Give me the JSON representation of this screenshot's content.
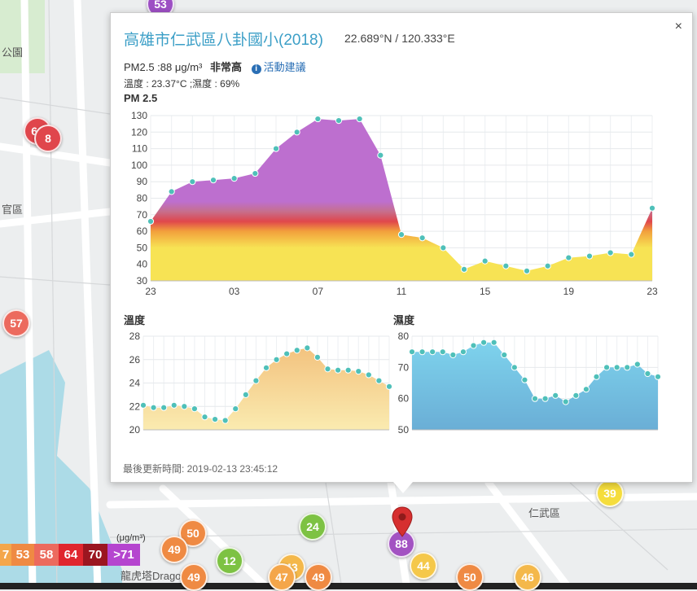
{
  "popup": {
    "title": "高雄市仁武區八卦國小(2018)",
    "coords": "22.689°N / 120.333°E",
    "pm_label": "PM2.5 :88 μg/m³",
    "pm_level": "非常高",
    "advice": "活動建議",
    "weather": "溫度 : 23.37°C ;濕度 : 69%",
    "pm_chart_title": "PM 2.5",
    "temp_chart_title": "溫度",
    "hum_chart_title": "濕度",
    "updated": "最後更新時間: 2019-02-13 23:45:12",
    "close": "×"
  },
  "legend": {
    "unit": "(μg/m³)",
    "items": [
      {
        "label": "7",
        "color": "#f4a64a"
      },
      {
        "label": "53",
        "color": "#ef8a43"
      },
      {
        "label": "58",
        "color": "#ec6a5e"
      },
      {
        "label": "64",
        "color": "#e0262e"
      },
      {
        "label": "70",
        "color": "#9b1620"
      },
      {
        "label": ">71",
        "color": "#b545cf"
      }
    ]
  },
  "map": {
    "labels": [
      "官區",
      "公園",
      "仁武區",
      "龍虎塔Dragon"
    ],
    "markers": [
      {
        "label": "53",
        "color": "#9d4fc4"
      },
      {
        "label": "60",
        "color": "#e0464c"
      },
      {
        "label": "8",
        "color": "#e0464c"
      },
      {
        "label": "57",
        "color": "#ec6a5e"
      },
      {
        "label": "39",
        "color": "#f5dd3c"
      },
      {
        "label": "50",
        "color": "#ef8a43"
      },
      {
        "label": "49",
        "color": "#ef8a43"
      },
      {
        "label": "24",
        "color": "#7dc243"
      },
      {
        "label": "12",
        "color": "#7dc243"
      },
      {
        "label": "43",
        "color": "#f4b84a"
      },
      {
        "label": "47",
        "color": "#f4a64a"
      },
      {
        "label": "49",
        "color": "#ef8a43"
      },
      {
        "label": "49",
        "color": "#ef8a43"
      },
      {
        "label": "88",
        "color": "#a352c2"
      },
      {
        "label": "44",
        "color": "#f5c84a"
      },
      {
        "label": "50",
        "color": "#ef8a43"
      },
      {
        "label": "46",
        "color": "#f4b84a"
      }
    ]
  },
  "chart_data": [
    {
      "type": "area",
      "title": "PM 2.5",
      "x_ticks": [
        "23",
        "03",
        "07",
        "11",
        "15",
        "19",
        "23"
      ],
      "ylim": [
        30,
        130
      ],
      "y_ticks": [
        30,
        40,
        50,
        60,
        70,
        80,
        90,
        100,
        110,
        120,
        130
      ],
      "values": [
        66,
        84,
        90,
        91,
        92,
        95,
        110,
        120,
        128,
        127,
        128,
        106,
        58,
        56,
        50,
        37,
        42,
        39,
        36,
        39,
        44,
        45,
        47,
        46,
        74
      ],
      "color_stops": [
        {
          "value": 30,
          "color": "#f7e354"
        },
        {
          "value": 50,
          "color": "#f7e354"
        },
        {
          "value": 60,
          "color": "#f2a03c"
        },
        {
          "value": 66,
          "color": "#e0464c"
        },
        {
          "value": 72,
          "color": "#c66f8d"
        },
        {
          "value": 78,
          "color": "#bd6fcf"
        },
        {
          "value": 130,
          "color": "#bd6fcf"
        }
      ],
      "marker_color": "#4fc0b9",
      "grid": true
    },
    {
      "type": "area",
      "title": "溫度",
      "ylim": [
        20,
        28
      ],
      "y_ticks": [
        20,
        22,
        24,
        26,
        28
      ],
      "values": [
        22.1,
        21.9,
        21.9,
        22.1,
        22.0,
        21.8,
        21.1,
        20.9,
        20.8,
        21.8,
        23.0,
        24.2,
        25.3,
        26.0,
        26.5,
        26.8,
        27.0,
        26.2,
        25.2,
        25.1,
        25.1,
        25.0,
        24.7,
        24.2,
        23.7
      ],
      "fill_top": "#f2bd78",
      "fill_bottom": "#faebb0",
      "marker_color": "#4fc0b9",
      "grid": true
    },
    {
      "type": "area",
      "title": "濕度",
      "ylim": [
        50,
        80
      ],
      "y_ticks": [
        50,
        60,
        70,
        80
      ],
      "values": [
        75,
        75,
        75,
        75,
        74,
        75,
        77,
        78,
        78,
        74,
        70,
        66,
        60,
        60,
        61,
        59,
        61,
        63,
        67,
        70,
        70,
        70,
        71,
        68,
        67
      ],
      "fill_top": "#7fd5ee",
      "fill_bottom": "#6aaed6",
      "marker_color": "#4fc0b9",
      "grid": true
    }
  ]
}
